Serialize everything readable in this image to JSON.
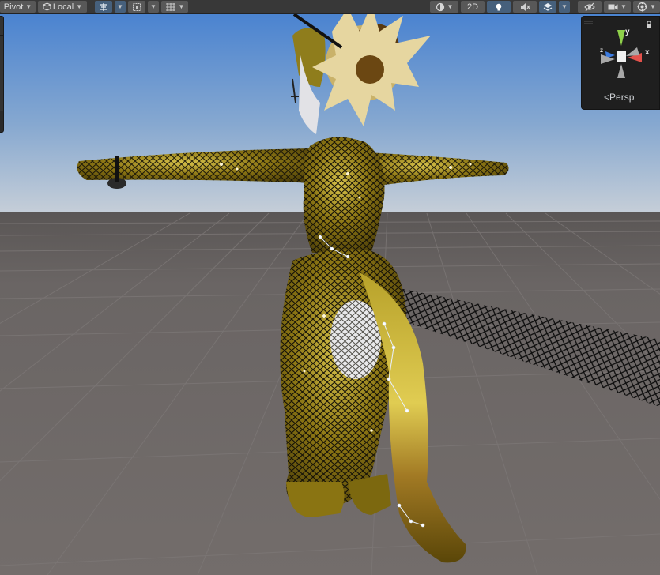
{
  "toolbar": {
    "pivot_mode": "Pivot",
    "pivot_rotation": "Local",
    "mode_2d": "2D",
    "icons": [
      "move-tool-icon",
      "snap-grid-icon",
      "grid-icon",
      "draw-mode-icon",
      "lighting-icon",
      "audio-mute-icon",
      "effects-icon",
      "visibility-icon",
      "camera-icon",
      "gizmos-icon"
    ]
  },
  "orientation_gizmo": {
    "axis_y": "y",
    "axis_x": "x",
    "axis_z": "z",
    "projection_label": "Persp",
    "colors": {
      "x": "#e2514b",
      "y": "#8fd14a",
      "z": "#3c7be0"
    }
  },
  "scene": {
    "sky_top": "#4d86d2",
    "sky_horizon": "#b9c7d6",
    "ground": "#6a6665",
    "character_base": "#7d6a14",
    "character_highlight": "#c9b23a"
  }
}
